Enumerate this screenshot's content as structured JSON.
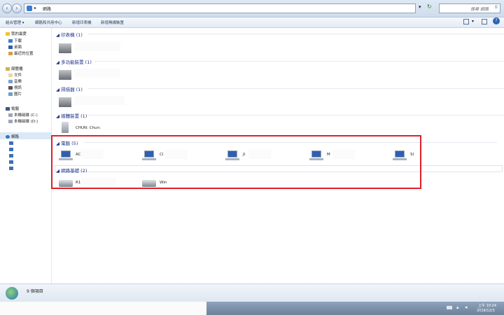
{
  "address": {
    "crumb": "網路",
    "search_placeholder": "搜尋 網路"
  },
  "toolbar": {
    "items": [
      "組合管理 ▾",
      "網路和共用中心",
      "新增印表機",
      "新增無線裝置"
    ]
  },
  "sidebar": {
    "favorites": {
      "title": "我的最愛",
      "items": [
        "下載",
        "桌面",
        "最近的位置"
      ]
    },
    "libraries": {
      "title": "媒體櫃",
      "items": [
        "文件",
        "音樂",
        "視訊",
        "圖片"
      ]
    },
    "computer": {
      "title": "電腦",
      "items": [
        "本機磁碟 (C:)",
        "本機磁碟 (D:)"
      ]
    },
    "network": {
      "title": "網路"
    }
  },
  "groups": {
    "printers": "印表機 (1)",
    "multifunction": "多功能裝置 (1)",
    "scanners": "掃描器 (1)",
    "media": "媒體裝置 (1)",
    "computers": "電腦 (5)",
    "infrastructure": "網路基礎 (2)"
  },
  "media_device": "CHUN: Chun:",
  "computers": [
    "AC",
    "CI",
    "JI",
    "M",
    "SI"
  ],
  "infrastructure": [
    "R1",
    "Win"
  ],
  "status": {
    "count": "9 個項目"
  },
  "clock": {
    "time": "上午 10:24",
    "date": "2018/12/3"
  },
  "colors": {
    "highlight": "#e0202a",
    "group_header": "#1e3287"
  }
}
